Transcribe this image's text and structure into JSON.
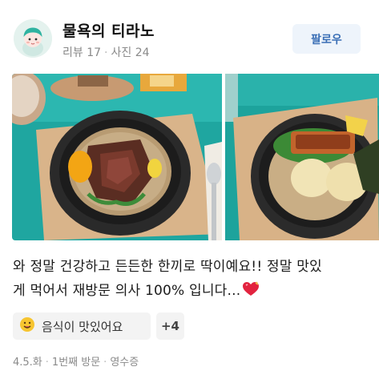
{
  "reviewer": {
    "name": "물욕의 티라노",
    "reviews_label": "리뷰 17",
    "photos_label": "사진 24",
    "avatar_icon": "character-avatar-icon"
  },
  "follow_button": {
    "label": "팔로우",
    "color": "#3b6fb6",
    "bg": "#eef4fb"
  },
  "photos": [
    {
      "name": "steak-bowl-photo",
      "icon": "food-photo"
    },
    {
      "name": "salmon-radish-bowl-photo",
      "icon": "food-photo"
    }
  ],
  "review": {
    "line1": "와 정말 건강하고 든든한 한끼로 딱이예요!! 정말 맛있",
    "line2": "게 먹어서 재방문 의사 100% 입니다...",
    "emoji_icon": "sparkling-heart-icon"
  },
  "tags": {
    "main_label": "음식이 맛있어요",
    "main_icon": "yum-face-emoji-icon",
    "more_label": "+4"
  },
  "visit_info": {
    "date": "4.5.화",
    "visit_count": "1번째 방문",
    "verification": "영수증"
  }
}
